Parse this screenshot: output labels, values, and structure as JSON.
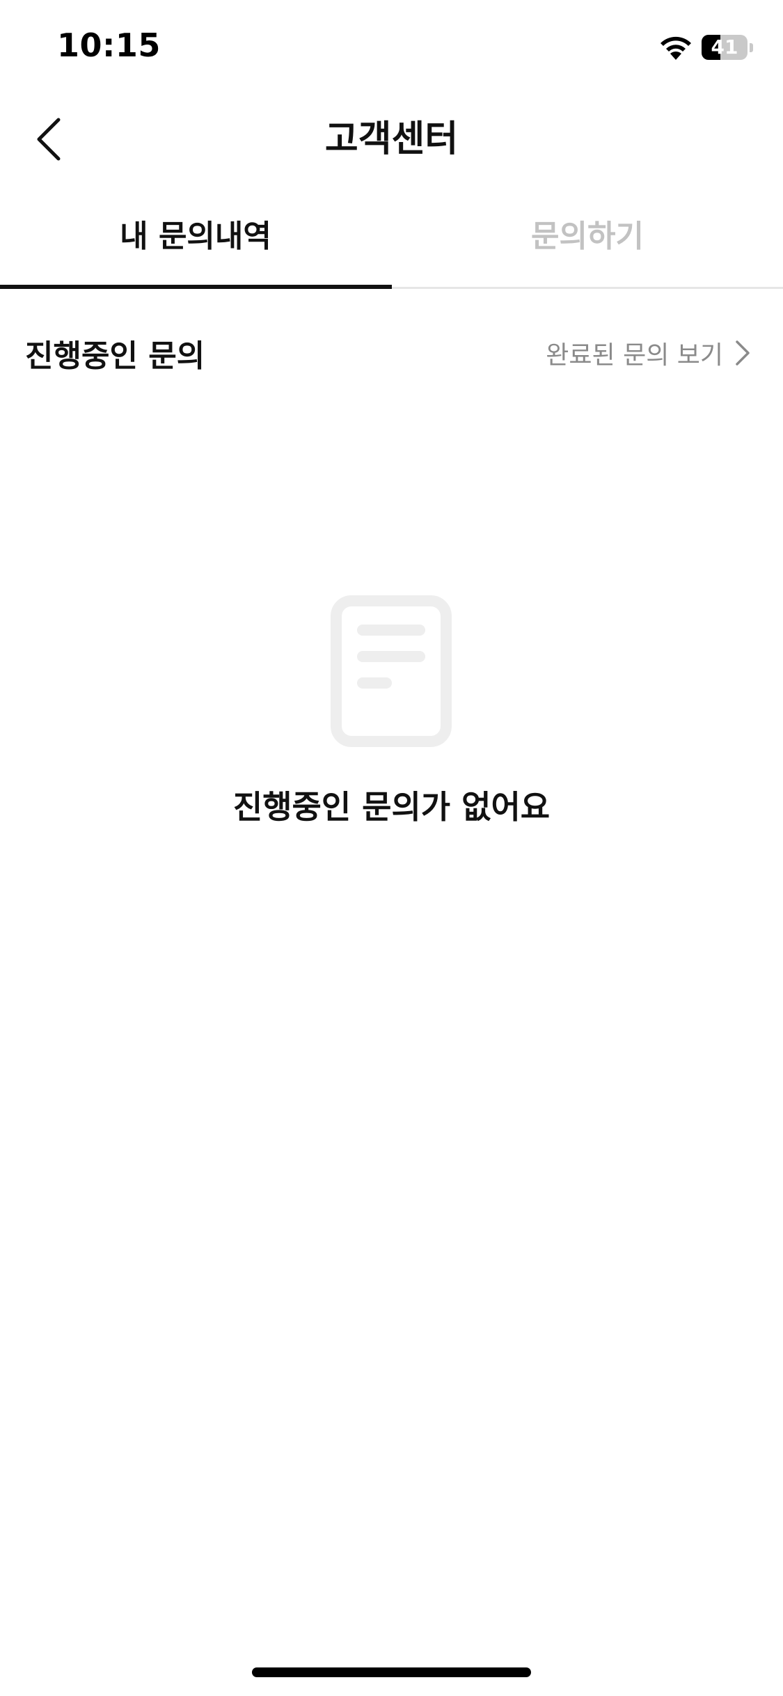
{
  "status_bar": {
    "time": "10:15",
    "battery_level": "41",
    "battery_fraction": 0.41
  },
  "nav": {
    "title": "고객센터",
    "back_icon": "chevron-left-icon"
  },
  "tabs": [
    {
      "label": "내 문의내역",
      "active": true
    },
    {
      "label": "문의하기",
      "active": false
    }
  ],
  "section": {
    "title": "진행중인 문의",
    "completed_link_label": "완료된 문의 보기",
    "link_icon": "chevron-right-icon"
  },
  "empty_state": {
    "icon": "document-icon",
    "message": "진행중인 문의가 없어요"
  },
  "colors": {
    "text_primary": "#111111",
    "text_inactive": "#c2c2c2",
    "text_secondary": "#8a8a8a",
    "icon_placeholder": "#eeeeee",
    "divider": "#e6e6e6"
  }
}
